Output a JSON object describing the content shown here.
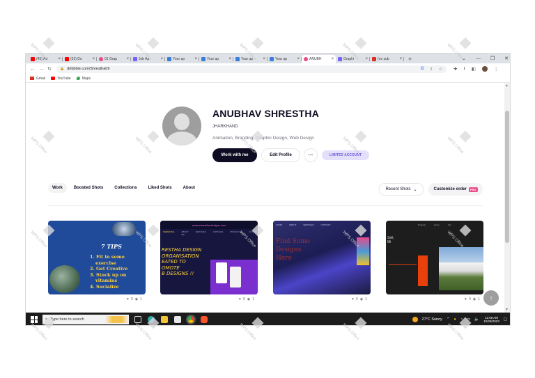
{
  "browser": {
    "tabs": [
      {
        "label": "(45) Ad",
        "color": "#ff0000"
      },
      {
        "label": "(33) Do",
        "color": "#ff0000"
      },
      {
        "label": "01 Grap",
        "color": "#ea4c89"
      },
      {
        "label": "Job Ap",
        "color": "#7b61ff"
      },
      {
        "label": "Your ap",
        "color": "#3b7ddd"
      },
      {
        "label": "Your ap",
        "color": "#3b7ddd"
      },
      {
        "label": "Your ap",
        "color": "#3b7ddd"
      },
      {
        "label": "Your ap",
        "color": "#3b7ddd"
      },
      {
        "label": "ANUBH",
        "color": "#ea4c89"
      },
      {
        "label": "Graphi",
        "color": "#7b61ff"
      },
      {
        "label": "(no sub",
        "color": "#d93025"
      }
    ],
    "new_tab": "+",
    "window_controls": [
      "⌄",
      "—",
      "❐",
      "✕"
    ],
    "url": "dribbble.com/Shrestha09",
    "bookmarks": [
      {
        "label": "Gmail",
        "color": "#d93025"
      },
      {
        "label": "YouTube",
        "color": "#ff0000"
      },
      {
        "label": "Maps",
        "color": "#34a853"
      }
    ]
  },
  "profile": {
    "name": "ANUBHAV SHRESTHA",
    "location": "JHARKHAND",
    "skills": "Animation, Branding, Graphic Design, Web Design",
    "work_with_me": "Work with me",
    "edit_profile": "Edit Profile",
    "more": "···",
    "limited": "LIMITED ACCOUNT"
  },
  "nav": {
    "items": [
      "Work",
      "Boosted Shots",
      "Collections",
      "Liked Shots",
      "About"
    ],
    "active": "Work",
    "recent": "Recent Shots",
    "customize": "Customize order",
    "pro": "PRO"
  },
  "shots": [
    {
      "likes": "0",
      "views": "1",
      "title": "7 TIPS",
      "lines": [
        "1. Fit in some",
        "exercise",
        "2. Get Creative",
        "3. Stock up on",
        "vitamins",
        "4. Socialize"
      ]
    },
    {
      "likes": "0",
      "views": "1",
      "header": "www.shrestha designs.com",
      "menu": [
        "SHRESTHA",
        "ABOUT ME",
        "SERVICES",
        "ARTICLES",
        "PRODUCTS",
        "CONTACT"
      ],
      "lines": [
        "RESTHA DESIGN",
        "ORGANISATION",
        "EATED TO",
        "OMOTE",
        "B DESIGNS !!"
      ]
    },
    {
      "likes": "0",
      "views": "1",
      "lines": [
        "Find Some",
        "Designs",
        "Here"
      ],
      "menu": [
        "HOME",
        "ABOUT",
        "SERVICES",
        "CONTACT"
      ]
    },
    {
      "likes": "0",
      "views": "1",
      "menu": [
        "Projects",
        "Home",
        "Info"
      ],
      "lines": [
        "Sell,",
        "Mi"
      ]
    }
  ],
  "taskbar": {
    "search_placeholder": "Type here to search",
    "weather": "27°C  Sunny",
    "time": "12:08 AM",
    "date": "10/28/2023"
  },
  "watermark": "WPS Office"
}
